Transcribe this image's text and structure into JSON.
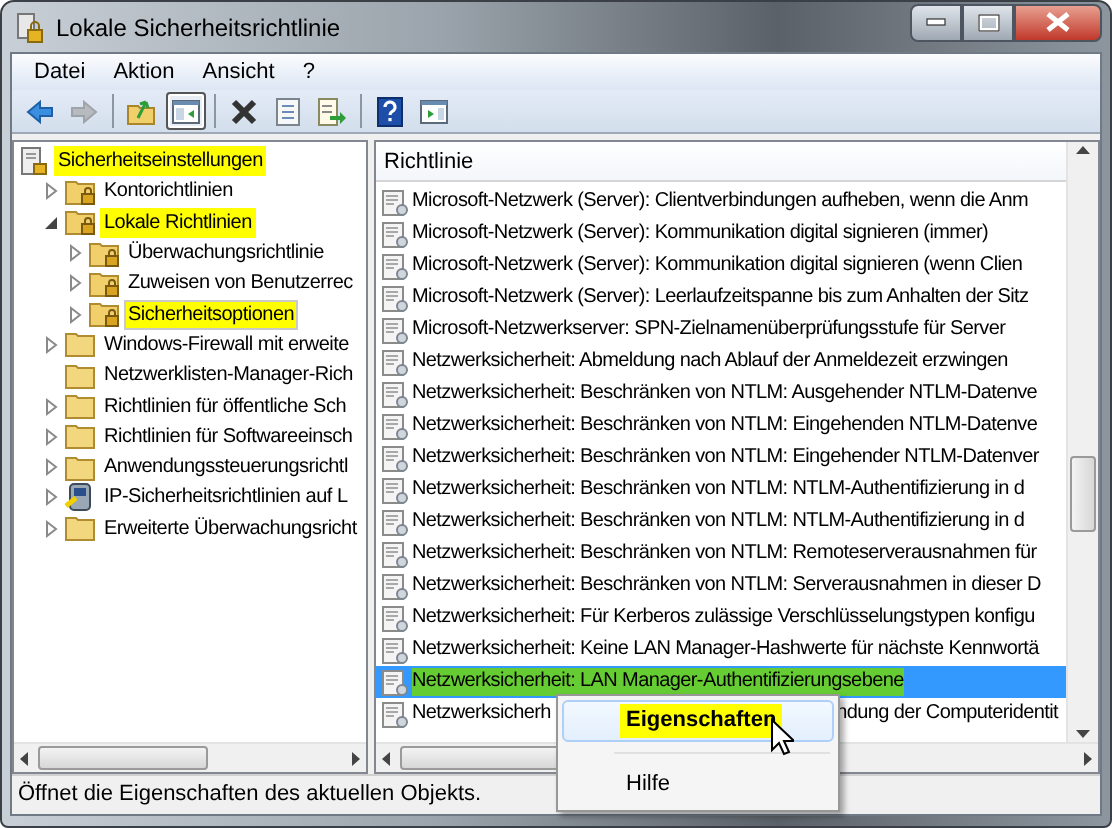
{
  "window": {
    "title": "Lokale Sicherheitsrichtlinie"
  },
  "menu": [
    "Datei",
    "Aktion",
    "Ansicht",
    "?"
  ],
  "toolbar": [
    {
      "kind": "back",
      "disabled": false,
      "pressed": false
    },
    {
      "kind": "forward",
      "disabled": true,
      "pressed": false
    },
    {
      "kind": "separator"
    },
    {
      "kind": "up",
      "disabled": false,
      "pressed": false
    },
    {
      "kind": "tree-toggle",
      "disabled": false,
      "pressed": true
    },
    {
      "kind": "separator"
    },
    {
      "kind": "delete",
      "disabled": false,
      "pressed": false
    },
    {
      "kind": "properties",
      "disabled": false,
      "pressed": false
    },
    {
      "kind": "export",
      "disabled": false,
      "pressed": false
    },
    {
      "kind": "separator"
    },
    {
      "kind": "help",
      "disabled": false,
      "pressed": false
    },
    {
      "kind": "action-pane",
      "disabled": false,
      "pressed": false
    }
  ],
  "tree": [
    {
      "label": "Sicherheitseinstellungen",
      "kind": "policy",
      "highlighted": true,
      "selected": false,
      "children": [
        {
          "label": "Kontorichtlinien",
          "kind": "locked-folder",
          "expanded": false,
          "highlighted": false,
          "selected": false
        },
        {
          "label": "Lokale Richtlinien",
          "kind": "locked-folder",
          "expanded": true,
          "highlighted": true,
          "selected": false,
          "children": [
            {
              "label": "Überwachungsrichtlinie",
              "kind": "locked-folder",
              "expanded": false,
              "highlighted": false,
              "selected": false
            },
            {
              "label": "Zuweisen von Benutzerrec",
              "kind": "locked-folder",
              "expanded": false,
              "highlighted": false,
              "selected": false
            },
            {
              "label": "Sicherheitsoptionen",
              "kind": "locked-folder",
              "expanded": false,
              "highlighted": true,
              "selected": true
            }
          ]
        },
        {
          "label": "Windows-Firewall mit erweite",
          "kind": "folder",
          "expanded": false,
          "highlighted": false,
          "selected": false
        },
        {
          "label": "Netzwerklisten-Manager-Rich",
          "kind": "folder",
          "highlighted": false,
          "selected": false
        },
        {
          "label": "Richtlinien für öffentliche Sch",
          "kind": "folder",
          "expanded": false,
          "highlighted": false,
          "selected": false
        },
        {
          "label": "Richtlinien für Softwareeinsch",
          "kind": "folder",
          "expanded": false,
          "highlighted": false,
          "selected": false
        },
        {
          "label": "Anwendungssteuerungsrichtl",
          "kind": "folder",
          "expanded": false,
          "highlighted": false,
          "selected": false
        },
        {
          "label": "IP-Sicherheitsrichtlinien auf L",
          "kind": "computer",
          "expanded": false,
          "highlighted": false,
          "selected": false
        },
        {
          "label": "Erweiterte Überwachungsricht",
          "kind": "folder",
          "expanded": false,
          "highlighted": false,
          "selected": false
        }
      ]
    }
  ],
  "list": {
    "column": "Richtlinie",
    "rows": [
      {
        "text": "Microsoft-Netzwerk (Server): Clientverbindungen aufheben, wenn die Anm",
        "selected": false,
        "highlighted": false
      },
      {
        "text": "Microsoft-Netzwerk (Server): Kommunikation digital signieren (immer)",
        "selected": false,
        "highlighted": false
      },
      {
        "text": "Microsoft-Netzwerk (Server): Kommunikation digital signieren (wenn Clien",
        "selected": false,
        "highlighted": false
      },
      {
        "text": "Microsoft-Netzwerk (Server): Leerlaufzeitspanne bis zum Anhalten der Sitz",
        "selected": false,
        "highlighted": false
      },
      {
        "text": "Microsoft-Netzwerkserver: SPN-Zielnamenüberprüfungsstufe für Server",
        "selected": false,
        "highlighted": false
      },
      {
        "text": "Netzwerksicherheit: Abmeldung nach Ablauf der Anmeldezeit erzwingen",
        "selected": false,
        "highlighted": false
      },
      {
        "text": "Netzwerksicherheit: Beschränken von NTLM: Ausgehender NTLM-Datenve",
        "selected": false,
        "highlighted": false
      },
      {
        "text": "Netzwerksicherheit: Beschränken von NTLM: Eingehenden NTLM-Datenve",
        "selected": false,
        "highlighted": false
      },
      {
        "text": "Netzwerksicherheit: Beschränken von NTLM: Eingehender NTLM-Datenver",
        "selected": false,
        "highlighted": false
      },
      {
        "text": "Netzwerksicherheit: Beschränken von NTLM: NTLM-Authentifizierung in d",
        "selected": false,
        "highlighted": false
      },
      {
        "text": "Netzwerksicherheit: Beschränken von NTLM: NTLM-Authentifizierung in d",
        "selected": false,
        "highlighted": false
      },
      {
        "text": "Netzwerksicherheit: Beschränken von NTLM: Remoteserverausnahmen für",
        "selected": false,
        "highlighted": false
      },
      {
        "text": "Netzwerksicherheit: Beschränken von NTLM: Serverausnahmen in dieser D",
        "selected": false,
        "highlighted": false
      },
      {
        "text": "Netzwerksicherheit: Für Kerberos zulässige Verschlüsselungstypen konfigu",
        "selected": false,
        "highlighted": false
      },
      {
        "text": "Netzwerksicherheit: Keine LAN Manager-Hashwerte für nächste Kennwortä",
        "selected": false,
        "highlighted": false
      },
      {
        "text": "Netzwerksicherheit: LAN Manager-Authentifizierungsebene",
        "selected": true,
        "highlighted": true
      },
      {
        "text": "Netzwerksicherh",
        "text_after_menu": "ndung der Computeridentit",
        "selected": false,
        "highlighted": false
      }
    ]
  },
  "context_menu": {
    "items": [
      {
        "kind": "item",
        "label": "Eigenschaften",
        "bold": true,
        "highlighted": true,
        "hovered": true
      },
      {
        "kind": "separator"
      },
      {
        "kind": "item",
        "label": "Hilfe",
        "bold": false,
        "highlighted": false,
        "hovered": false
      }
    ]
  },
  "status_bar": {
    "text": "Öffnet die Eigenschaften des aktuellen Objekts."
  }
}
